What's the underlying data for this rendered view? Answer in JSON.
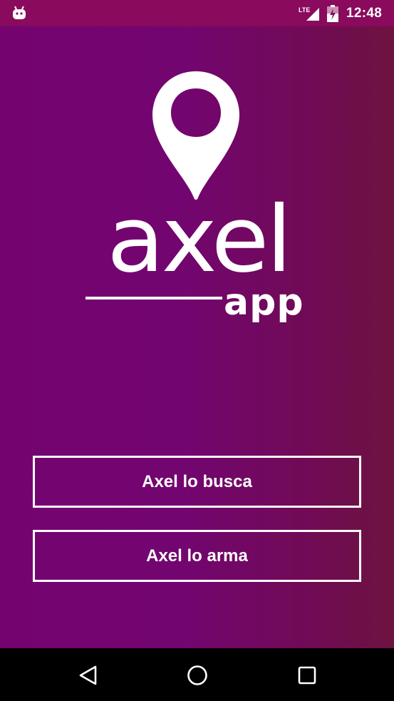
{
  "status_bar": {
    "time": "12:48",
    "network": "LTE",
    "icons": [
      "android-debug-icon",
      "lte-signal-icon",
      "battery-charging-icon"
    ]
  },
  "logo": {
    "name": "axel",
    "suffix": "app",
    "icon": "location-pin-icon"
  },
  "buttons": {
    "busca_label": "Axel lo busca",
    "arma_label": "Axel lo arma"
  },
  "nav_bar": {
    "icons": [
      "back-icon",
      "home-icon",
      "recents-icon"
    ]
  },
  "colors": {
    "status_bar": "#8a0a5e",
    "gradient_start": "#74036f",
    "gradient_end": "#6d1340",
    "foreground": "#ffffff"
  }
}
